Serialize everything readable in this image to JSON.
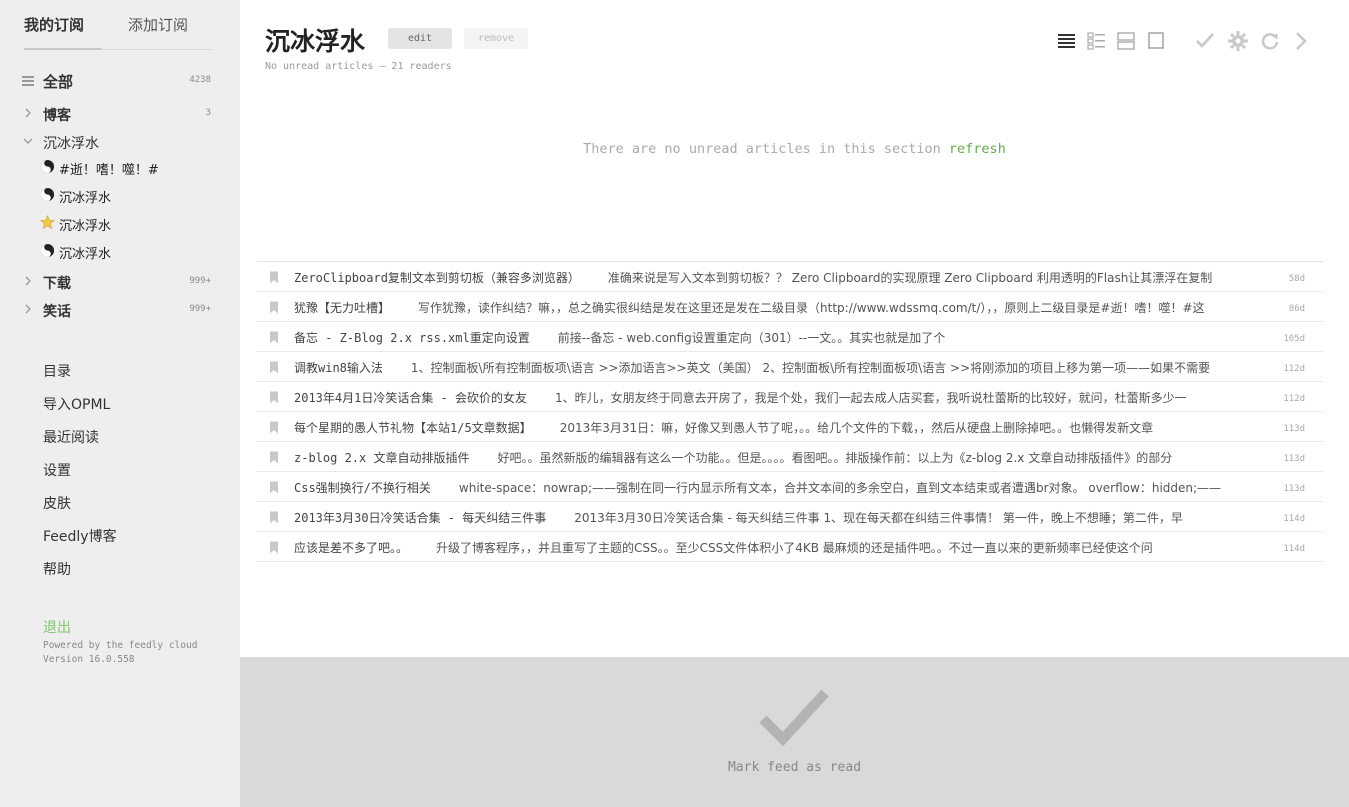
{
  "sidebar": {
    "tabs": [
      "我的订阅",
      "添加订阅"
    ],
    "all": {
      "label": "全部",
      "count": "4238"
    },
    "categories": [
      {
        "label": "博客",
        "count": "3",
        "bold": true
      },
      {
        "label": "沉冰浮水",
        "count": "",
        "bold": false
      },
      {
        "label": "下载",
        "count": "999+",
        "bold": true
      },
      {
        "label": "笑话",
        "count": "999+",
        "bold": true
      }
    ],
    "feeds": [
      {
        "label": "#逝！嗜！噬！#",
        "icon": "yin-yang-icon"
      },
      {
        "label": "沉冰浮水",
        "icon": "yin-yang-icon"
      },
      {
        "label": "沉冰浮水",
        "icon": "star-icon"
      },
      {
        "label": "沉冰浮水",
        "icon": "yin-yang-icon"
      }
    ],
    "menu": [
      "目录",
      "导入OPML",
      "最近阅读",
      "设置",
      "皮肤",
      "Feedly博客",
      "帮助"
    ],
    "logout": "退出",
    "powered": "Powered by the feedly cloud",
    "version": "Version 16.0.558"
  },
  "header": {
    "title": "沉冰浮水",
    "edit": "edit",
    "remove": "remove",
    "subtitle": "No unread articles — 21 readers",
    "toolbar_icons": [
      "list-view-icon",
      "magazine-view-icon",
      "card-view-icon",
      "full-article-view-icon",
      "checkmark-icon",
      "gear-icon",
      "refresh-icon",
      "next-arrow-icon"
    ]
  },
  "empty": {
    "message": "There are no unread articles in this section",
    "refresh": "refresh"
  },
  "articles": [
    {
      "title": "ZeroClipboard复制文本到剪切板（兼容多浏览器）",
      "snippet": "准确来说是写入文本到剪切板？？ Zero Clipboard的实现原理 Zero Clipboard 利用透明的Flash让其漂浮在复制",
      "age": "58d"
    },
    {
      "title": "犹豫【无力吐槽】",
      "snippet": "写作犹豫，读作纠结？嘛，，总之确实很纠结是发在这里还是发在二级目录（http://www.wdssmq.com/t/），，原则上二级目录是#逝！嗜！噬！#这",
      "age": "86d"
    },
    {
      "title": "备忘 - Z-Blog 2.x rss.xml重定向设置",
      "snippet": "前接--备忘 - web.config设置重定向（301）--一文。。其实也就是加了个",
      "age": "105d"
    },
    {
      "title": "调教win8输入法",
      "snippet": "1、控制面板\\所有控制面板项\\语言 >>添加语言>>英文（美国） 2、控制面板\\所有控制面板项\\语言 >>将刚添加的项目上移为第一项——如果不需要",
      "age": "112d"
    },
    {
      "title": "2013年4月1日冷笑话合集 - 会砍价的女友",
      "snippet": "1、昨儿，女朋友终于同意去开房了，我是个处，我们一起去成人店买套，我听说杜蕾斯的比较好，就问，杜蕾斯多少一",
      "age": "112d"
    },
    {
      "title": "每个星期的愚人节礼物【本站1/5文章数据】",
      "snippet": "2013年3月31日：嘛，好像又到愚人节了呢，。。给几个文件的下载，，然后从硬盘上删除掉吧。。也懒得发新文章",
      "age": "113d"
    },
    {
      "title": "z-blog 2.x 文章自动排版插件",
      "snippet": "好吧。。虽然新版的编辑器有这么一个功能。。但是。。。。看图吧。。排版操作前：以上为《z-blog 2.x 文章自动排版插件》的部分",
      "age": "113d"
    },
    {
      "title": "Css强制换行/不换行相关",
      "snippet": "white-space：nowrap;——强制在同一行内显示所有文本，合并文本间的多余空白，直到文本结束或者遭遇br对象。 overflow：hidden;——",
      "age": "113d"
    },
    {
      "title": "2013年3月30日冷笑话合集 - 每天纠结三件事",
      "snippet": "2013年3月30日冷笑话合集 - 每天纠结三件事 1、现在每天都在纠结三件事情！ 第一件，晚上不想睡；第二件，早",
      "age": "114d"
    },
    {
      "title": "应该是差不多了吧。。",
      "snippet": "升级了博客程序，，并且重写了主题的CSS。。至少CSS文件体积小了4KB 最麻烦的还是插件吧。。不过一直以来的更新频率已经使这个问",
      "age": "114d"
    }
  ],
  "footer": {
    "mark_read": "Mark feed as read"
  },
  "colors": {
    "accent_green": "#6aaa52",
    "sidebar_bg": "#eeeeee",
    "footer_bg": "#d9d9d9"
  }
}
